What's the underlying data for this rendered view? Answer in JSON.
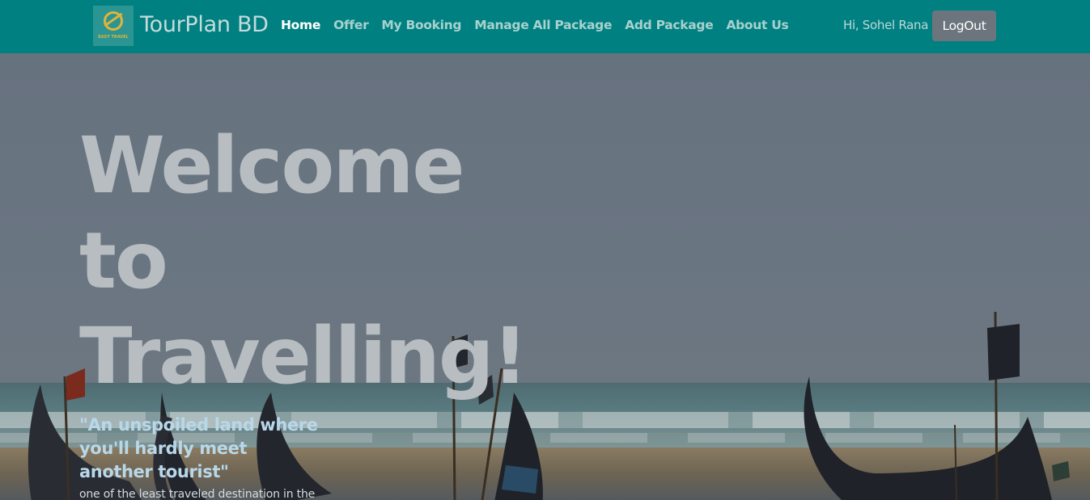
{
  "brand": {
    "name": "TourPlan BD",
    "logo_icon": "easy-travel-logo",
    "logo_text": "EASY TRAVEL"
  },
  "nav": {
    "items": [
      {
        "label": "Home",
        "active": true
      },
      {
        "label": "Offer",
        "active": false
      },
      {
        "label": "My Booking",
        "active": false
      },
      {
        "label": "Manage All Package",
        "active": false
      },
      {
        "label": "Add Package",
        "active": false
      },
      {
        "label": "About Us",
        "active": false
      }
    ]
  },
  "user": {
    "greeting": "Hi, Sohel Rana",
    "logout_label": "LogOut"
  },
  "hero": {
    "title_line1": "Welcome",
    "title_line2": "to",
    "title_line3": "Travelling!",
    "quote": "\"An unspoiled land where you'll hardly meet another tourist\"",
    "subtext": "one of the least traveled destination in the"
  },
  "colors": {
    "navbar": "#008080",
    "logout_button": "#6c757d",
    "quote": "#b8d8ea"
  }
}
